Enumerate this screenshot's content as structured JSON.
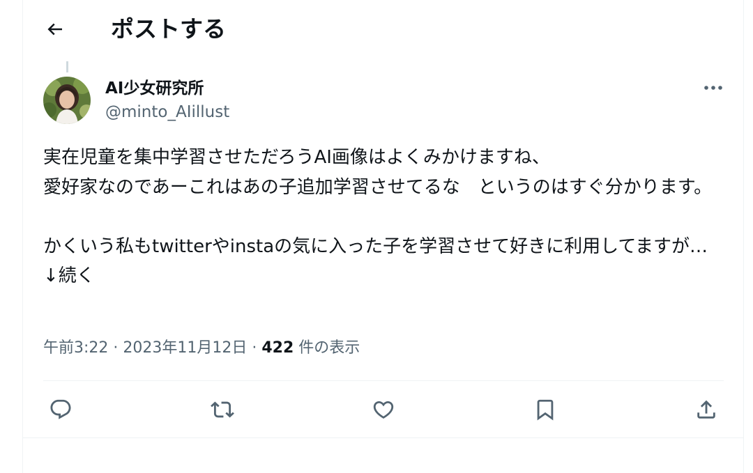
{
  "header": {
    "title": "ポストする",
    "back_icon": "arrow-left-icon"
  },
  "author": {
    "name": "AI少女研究所",
    "handle": "@minto_AIillust",
    "avatar": "avatar-photo"
  },
  "post": {
    "text": "実在児童を集中学習させただろうAI画像はよくみかけますね、\n愛好家なのであーこれはあの子追加学習させてるな　というのはすぐ分かります。\n\nかくいう私もtwitterやinstaの気に入った子を学習させて好きに利用してますが…　↓続く"
  },
  "meta": {
    "time": "午前3:22",
    "sep1": " · ",
    "date": "2023年11月12日",
    "sep2": " · ",
    "views_count": "422",
    "views_label": " 件の表示"
  },
  "actions": [
    {
      "icon": "reply-icon"
    },
    {
      "icon": "repost-icon"
    },
    {
      "icon": "like-icon"
    },
    {
      "icon": "bookmark-icon"
    },
    {
      "icon": "share-icon"
    }
  ],
  "colors": {
    "text": "#0f1419",
    "secondary": "#536471",
    "divider": "#eff3f4"
  }
}
